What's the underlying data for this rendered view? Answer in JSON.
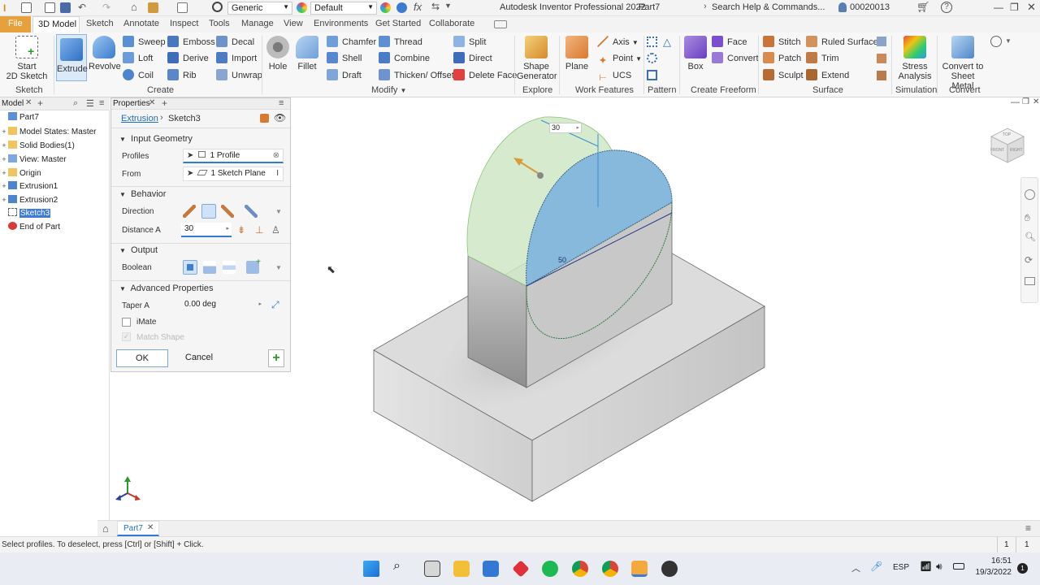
{
  "titlebar": {
    "app_title": "Autodesk Inventor Professional 2022",
    "doc_name": "Part7",
    "appearance_select": "Generic",
    "material_select": "Default",
    "search_placeholder": "Search Help & Commands...",
    "user": "00020013"
  },
  "tabs": [
    {
      "label": "File"
    },
    {
      "label": "3D Model"
    },
    {
      "label": "Sketch"
    },
    {
      "label": "Annotate"
    },
    {
      "label": "Inspect"
    },
    {
      "label": "Tools"
    },
    {
      "label": "Manage"
    },
    {
      "label": "View"
    },
    {
      "label": "Environments"
    },
    {
      "label": "Get Started"
    },
    {
      "label": "Collaborate"
    }
  ],
  "ribbon": {
    "sketch": {
      "start_sketch": "Start",
      "start_sketch2": "2D Sketch",
      "group": "Sketch"
    },
    "create": {
      "extrude": "Extrude",
      "revolve": "Revolve",
      "sweep": "Sweep",
      "emboss": "Emboss",
      "decal": "Decal",
      "loft": "Loft",
      "derive": "Derive",
      "import": "Import",
      "coil": "Coil",
      "rib": "Rib",
      "unwrap": "Unwrap",
      "group": "Create"
    },
    "modify": {
      "hole": "Hole",
      "fillet": "Fillet",
      "chamfer": "Chamfer",
      "thread": "Thread",
      "split": "Split",
      "shell": "Shell",
      "combine": "Combine",
      "direct": "Direct",
      "draft": "Draft",
      "thicken": "Thicken/ Offset",
      "delete_face": "Delete Face",
      "group": "Modify"
    },
    "explore": {
      "shape_gen": "Shape",
      "shape_gen2": "Generator",
      "group": "Explore"
    },
    "work": {
      "plane": "Plane",
      "axis": "Axis",
      "point": "Point",
      "ucs": "UCS",
      "group": "Work Features"
    },
    "pattern": {
      "group": "Pattern"
    },
    "freeform": {
      "box": "Box",
      "face": "Face",
      "convert": "Convert",
      "group": "Create Freeform"
    },
    "surface": {
      "stitch": "Stitch",
      "ruled": "Ruled Surface",
      "patch": "Patch",
      "trim": "Trim",
      "sculpt": "Sculpt",
      "extend": "Extend",
      "group": "Surface"
    },
    "simulation": {
      "stress": "Stress",
      "stress2": "Analysis",
      "group": "Simulation"
    },
    "convert": {
      "sheet": "Convert to",
      "sheet2": "Sheet Metal",
      "group": "Convert"
    }
  },
  "browser": {
    "tab": "Model",
    "nodes": [
      {
        "label": "Part7"
      },
      {
        "label": "Model States: Master"
      },
      {
        "label": "Solid Bodies(1)"
      },
      {
        "label": "View: Master"
      },
      {
        "label": "Origin"
      },
      {
        "label": "Extrusion1"
      },
      {
        "label": "Extrusion2"
      },
      {
        "label": "Sketch3"
      },
      {
        "label": "End of Part"
      }
    ]
  },
  "properties": {
    "tab": "Properties",
    "crumb1": "Extrusion",
    "crumb2": "Sketch3",
    "input_geometry": "Input Geometry",
    "profiles_label": "Profiles",
    "profiles_value": "1 Profile",
    "from_label": "From",
    "from_value": "1 Sketch Plane",
    "behavior": "Behavior",
    "direction_label": "Direction",
    "distance_label": "Distance A",
    "distance_value": "30",
    "output": "Output",
    "boolean_label": "Boolean",
    "advanced": "Advanced Properties",
    "taper_label": "Taper A",
    "taper_value": "0.00 deg",
    "imate_label": "iMate",
    "match_shape_label": "Match Shape",
    "ok": "OK",
    "cancel": "Cancel"
  },
  "viewport": {
    "distance_input": "30",
    "dimension_label": "50",
    "viewcube_front": "FRONT",
    "viewcube_right": "RIGHT",
    "viewcube_top": "TOP"
  },
  "doc_tab": "Part7",
  "status": {
    "message": "Select profiles. To deselect, press [Ctrl] or [Shift] + Click.",
    "count1": "1",
    "count2": "1"
  },
  "taskbar": {
    "lang": "ESP",
    "time": "16:51",
    "date": "19/3/2022",
    "notif": "1"
  }
}
